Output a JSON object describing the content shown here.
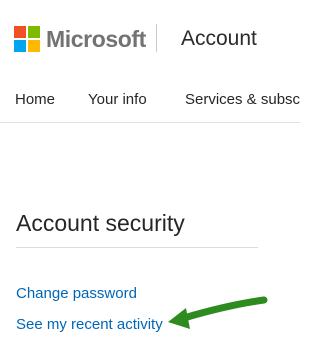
{
  "header": {
    "brand": "Microsoft",
    "section": "Account",
    "logo_colors": [
      "#f25022",
      "#7fba00",
      "#00a4ef",
      "#ffb900"
    ]
  },
  "nav": {
    "items": [
      {
        "label": "Home"
      },
      {
        "label": "Your info"
      },
      {
        "label": "Services & subsc"
      }
    ]
  },
  "main": {
    "section_title": "Account security",
    "links": [
      {
        "label": "Change password"
      },
      {
        "label": "See my recent activity"
      }
    ]
  },
  "annotation": {
    "arrow_color": "#2e8b1f",
    "points_to": "See my recent activity"
  },
  "colors": {
    "link": "#0067b8",
    "text": "#262626",
    "brand_text": "#737373"
  }
}
